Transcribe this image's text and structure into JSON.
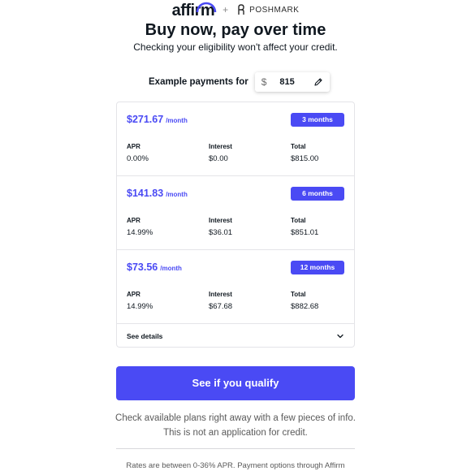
{
  "header": {
    "affirm_logo_text": "affirm",
    "plus": "+",
    "partner_name": "POSHMARK"
  },
  "title": "Buy now, pay over time",
  "subtitle": "Checking your eligibility won't affect your credit.",
  "example": {
    "label": "Example payments for",
    "currency_symbol": "$",
    "amount": "815"
  },
  "plans": [
    {
      "monthly": "$271.67",
      "per": "/month",
      "term": "3 months",
      "apr_label": "APR",
      "apr": "0.00%",
      "interest_label": "Interest",
      "interest": "$0.00",
      "total_label": "Total",
      "total": "$815.00"
    },
    {
      "monthly": "$141.83",
      "per": "/month",
      "term": "6 months",
      "apr_label": "APR",
      "apr": "14.99%",
      "interest_label": "Interest",
      "interest": "$36.01",
      "total_label": "Total",
      "total": "$851.01"
    },
    {
      "monthly": "$73.56",
      "per": "/month",
      "term": "12 months",
      "apr_label": "APR",
      "apr": "14.99%",
      "interest_label": "Interest",
      "interest": "$67.68",
      "total_label": "Total",
      "total": "$882.68"
    }
  ],
  "see_details": "See details",
  "cta_label": "See if you qualify",
  "note_line1": "Check available plans right away with a few pieces of info.",
  "note_line2": "This is not an application for credit.",
  "rates_text": "Rates are between 0-36% APR. Payment options through Affirm",
  "colors": {
    "accent": "#4a4af4",
    "text": "#101820",
    "muted": "#5a5a5a",
    "border": "#e4e4e8"
  },
  "icons": {
    "edit": "pencil-icon",
    "expand": "chevron-down-icon",
    "partner": "poshmark-icon"
  }
}
